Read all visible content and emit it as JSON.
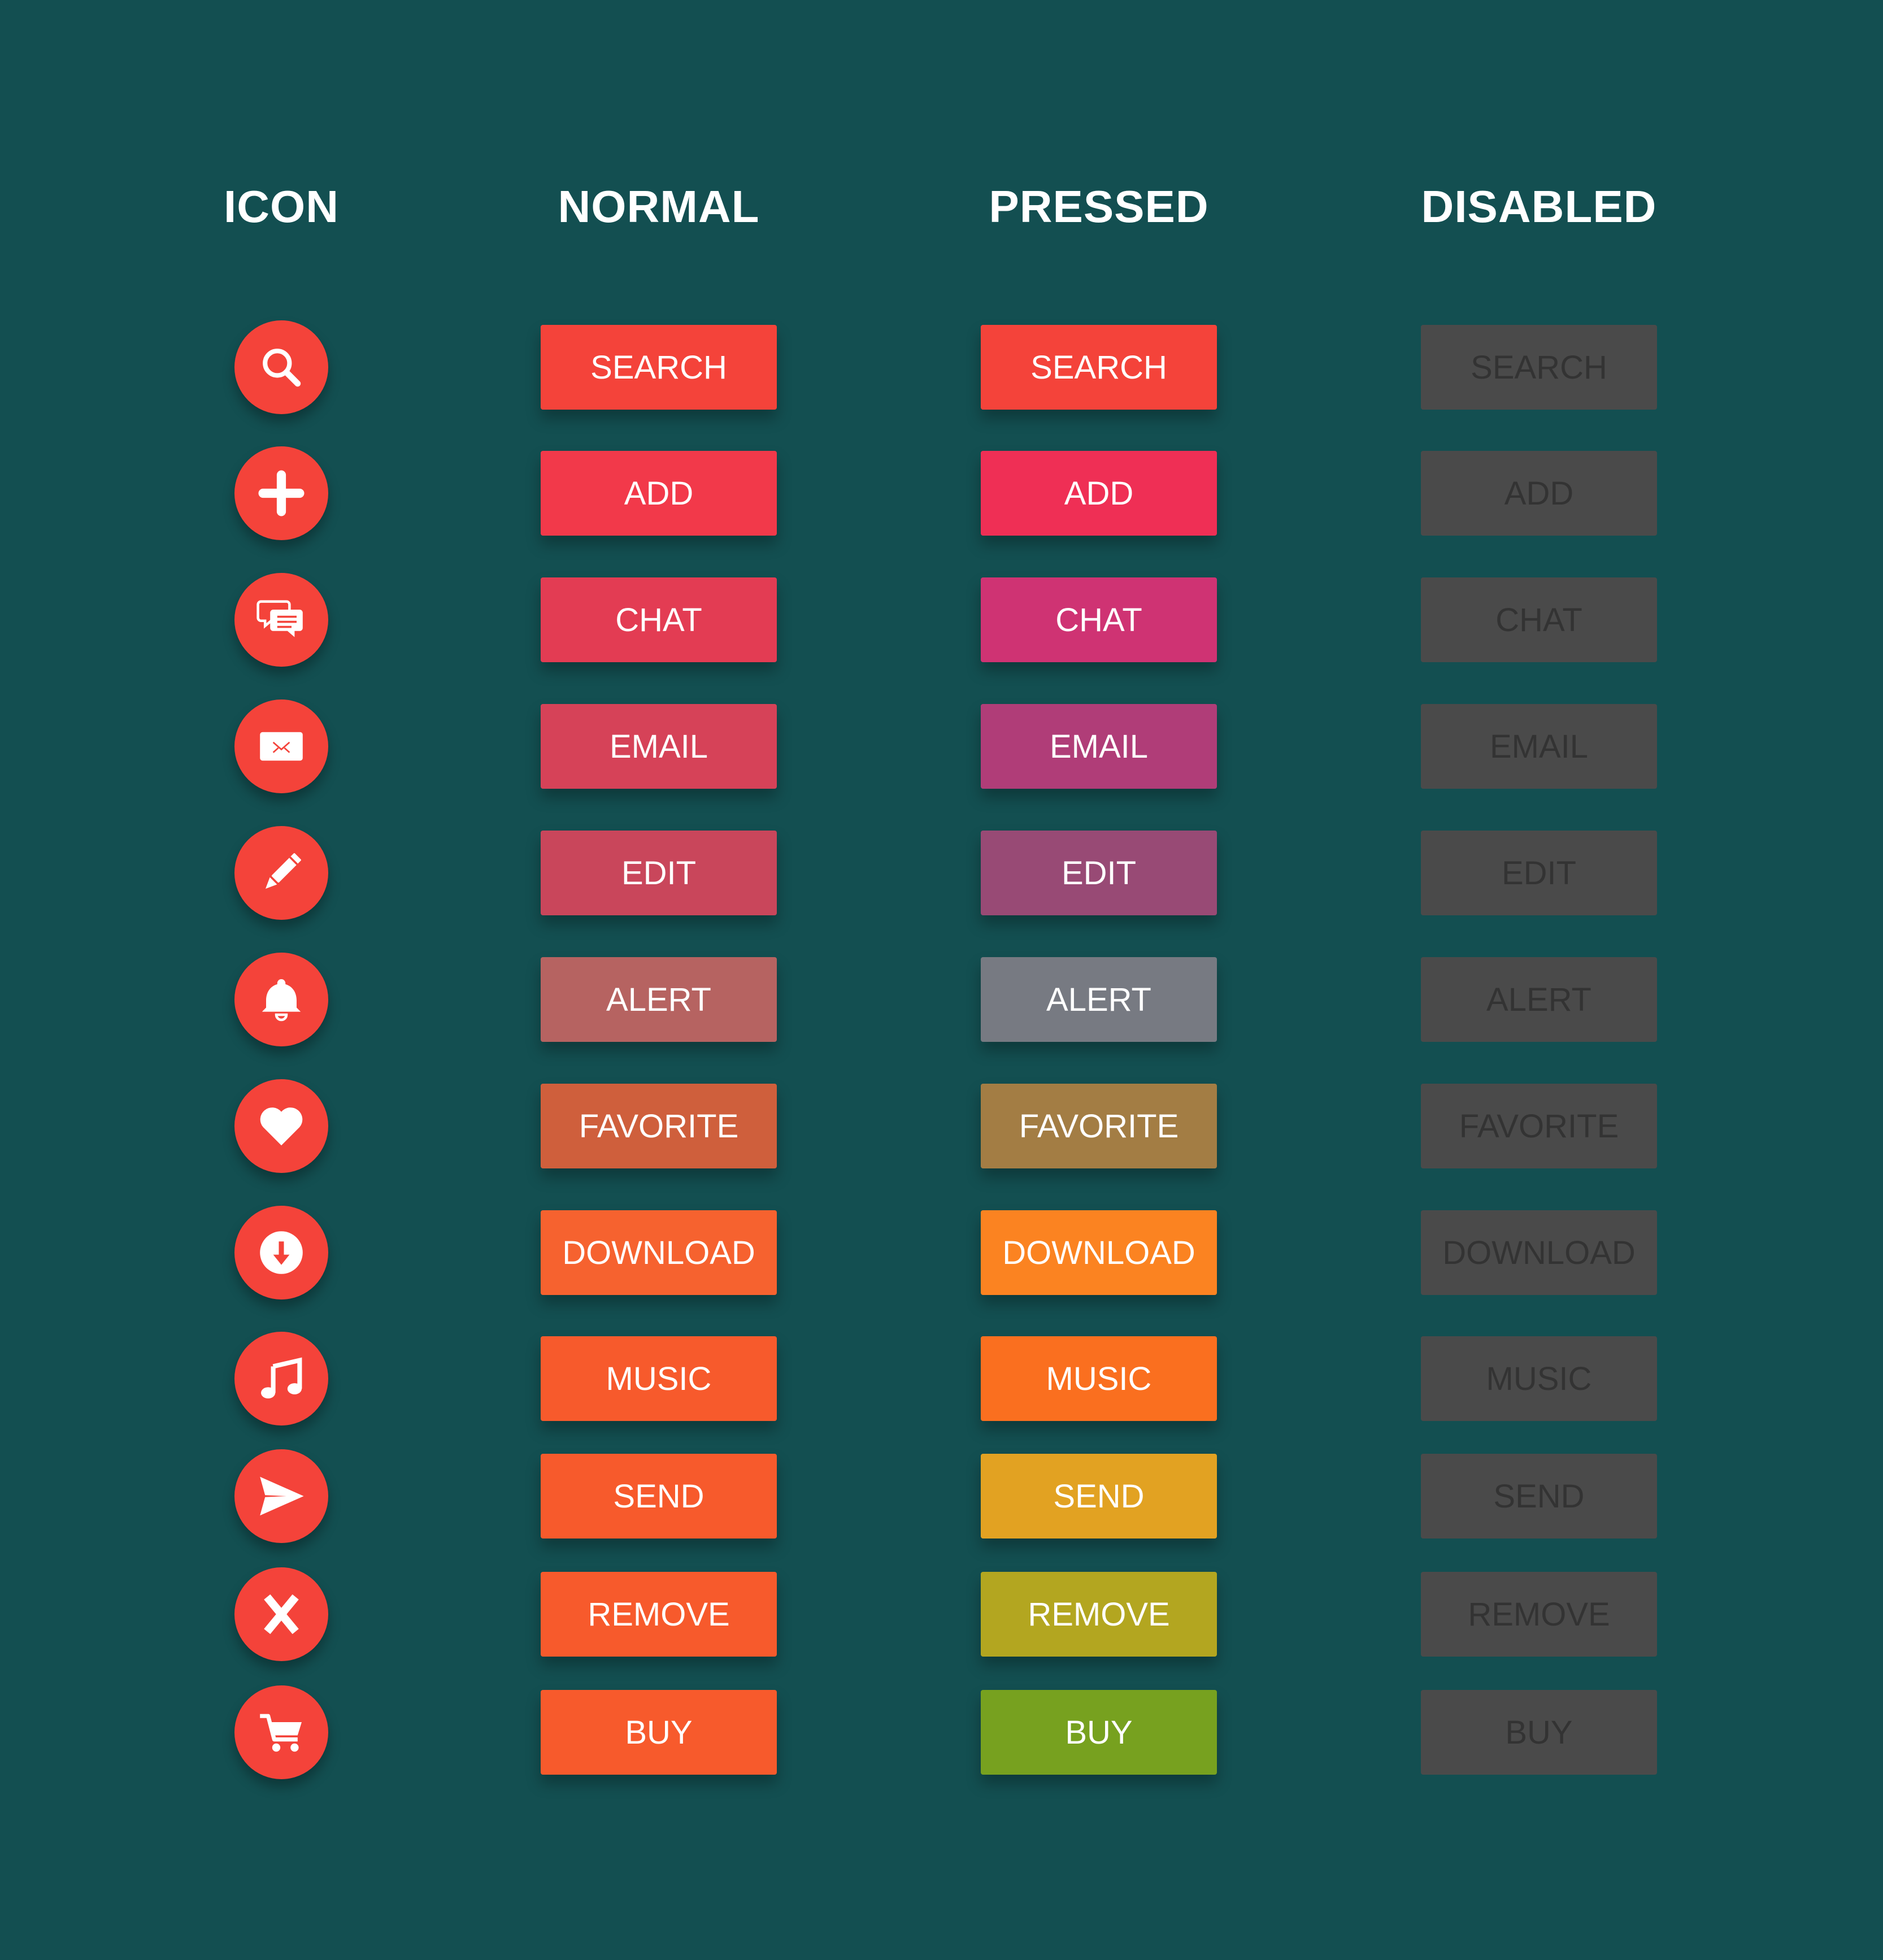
{
  "columns": {
    "icon": "ICON",
    "normal": "NORMAL",
    "pressed": "PRESSED",
    "disabled": "DISABLED"
  },
  "icon_color": "#f4433a",
  "disabled_color": "#4a4a4a",
  "disabled_text_color": "#333333",
  "background": "#134f51",
  "rows": [
    {
      "label": "SEARCH",
      "icon": "search-icon",
      "normal_color": "#f4433a",
      "pressed_color": "#f4433a"
    },
    {
      "label": "ADD",
      "icon": "plus-icon",
      "normal_color": "#f2394a",
      "pressed_color": "#ef2f55"
    },
    {
      "label": "CHAT",
      "icon": "chat-icon",
      "normal_color": "#e33c53",
      "pressed_color": "#cf3373"
    },
    {
      "label": "EMAIL",
      "icon": "envelope-icon",
      "normal_color": "#d64258",
      "pressed_color": "#b03d78"
    },
    {
      "label": "EDIT",
      "icon": "pencil-icon",
      "normal_color": "#c9465b",
      "pressed_color": "#984a75"
    },
    {
      "label": "ALERT",
      "icon": "bell-icon",
      "normal_color": "#b66361",
      "pressed_color": "#777a82"
    },
    {
      "label": "FAVORITE",
      "icon": "heart-icon",
      "normal_color": "#cf5f3c",
      "pressed_color": "#a37d44"
    },
    {
      "label": "DOWNLOAD",
      "icon": "download-icon",
      "normal_color": "#f6622f",
      "pressed_color": "#fb8321"
    },
    {
      "label": "MUSIC",
      "icon": "music-icon",
      "normal_color": "#f75a2c",
      "pressed_color": "#fa6f1f"
    },
    {
      "label": "SEND",
      "icon": "send-icon",
      "normal_color": "#f75a2c",
      "pressed_color": "#e2a222"
    },
    {
      "label": "REMOVE",
      "icon": "x-icon",
      "normal_color": "#f75a2c",
      "pressed_color": "#b3a620"
    },
    {
      "label": "BUY",
      "icon": "cart-icon",
      "normal_color": "#f75a2c",
      "pressed_color": "#77a11f"
    }
  ]
}
